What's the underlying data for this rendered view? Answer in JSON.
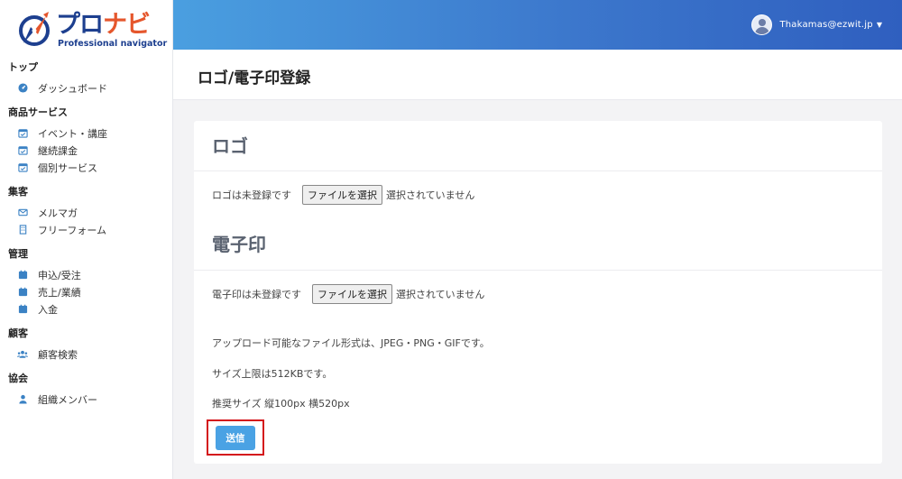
{
  "brand": {
    "name_part1": "プロ",
    "name_part2": "ナビ",
    "tagline": "Professional navigator"
  },
  "header": {
    "user_name": "Thakamas@ezwit.jp"
  },
  "page": {
    "title": "ロゴ/電子印登録"
  },
  "sidebar": {
    "sections": [
      {
        "heading": "トップ",
        "items": [
          {
            "label": "ダッシュボード",
            "icon": "dashboard-icon"
          }
        ]
      },
      {
        "heading": "商品サービス",
        "items": [
          {
            "label": "イベント・講座",
            "icon": "calendar-check-icon"
          },
          {
            "label": "継続課金",
            "icon": "calendar-check-icon"
          },
          {
            "label": "個別サービス",
            "icon": "calendar-check-icon"
          }
        ]
      },
      {
        "heading": "集客",
        "items": [
          {
            "label": "メルマガ",
            "icon": "envelope-icon"
          },
          {
            "label": "フリーフォーム",
            "icon": "building-icon"
          }
        ]
      },
      {
        "heading": "管理",
        "items": [
          {
            "label": "申込/受注",
            "icon": "calendar-icon"
          },
          {
            "label": "売上/業績",
            "icon": "calendar-icon"
          },
          {
            "label": "入金",
            "icon": "calendar-icon"
          }
        ]
      },
      {
        "heading": "顧客",
        "items": [
          {
            "label": "顧客検索",
            "icon": "users-icon"
          }
        ]
      },
      {
        "heading": "協会",
        "items": [
          {
            "label": "組織メンバー",
            "icon": "user-icon"
          }
        ]
      }
    ]
  },
  "logo_section": {
    "title": "ロゴ",
    "status_text": "ロゴは未登録です",
    "file_button": "ファイルを選択",
    "file_status": "選択されていません"
  },
  "seal_section": {
    "title": "電子印",
    "status_text": "電子印は未登録です",
    "file_button": "ファイルを選択",
    "file_status": "選択されていません"
  },
  "notes": {
    "formats": "アップロード可能なファイル形式は、JPEG・PNG・GIFです。",
    "size_limit": "サイズ上限は512KBです。",
    "recommended": "推奨サイズ 縦100px 横520px"
  },
  "submit": {
    "label": "送信"
  },
  "colors": {
    "header_gradient_start": "#4a9fe0",
    "header_gradient_end": "#2f5fbf",
    "brand_navy": "#1d3f8f",
    "brand_orange": "#e5562c",
    "icon_blue": "#3b82c4",
    "submit_blue": "#4aa2e4",
    "highlight_red": "#d4161c"
  }
}
